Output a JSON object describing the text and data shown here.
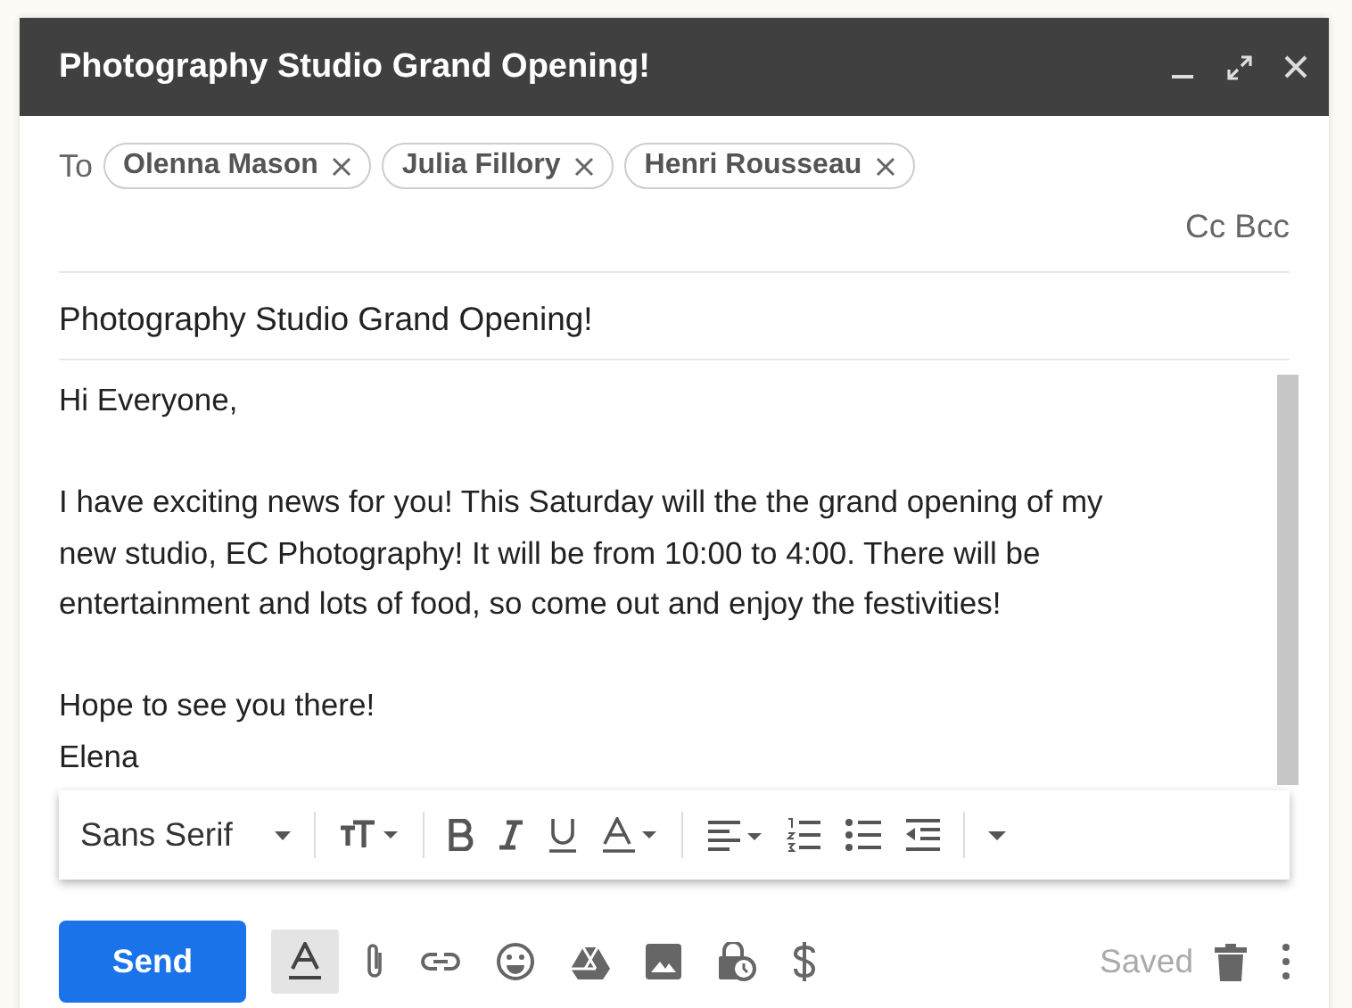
{
  "window": {
    "title": "Photography Studio Grand Opening!"
  },
  "recipients": {
    "label": "To",
    "chips": [
      "Olenna Mason",
      "Julia Fillory",
      "Henri Rousseau"
    ],
    "cc": "Cc",
    "bcc": "Bcc"
  },
  "subject": {
    "value": "Photography Studio Grand Opening!"
  },
  "body": {
    "paragraphs": [
      [
        "Hi Everyone,"
      ],
      [
        "I have exciting news for you! This Saturday will the the grand opening of my",
        "new studio, EC Photography! It will be from 10:00 to 4:00. There will be",
        "entertainment and lots of food, so come out and enjoy the festivities!"
      ],
      [
        "Hope to see you there!",
        "Elena"
      ]
    ]
  },
  "format_toolbar": {
    "font": "Sans Serif"
  },
  "bottom_bar": {
    "send": "Send",
    "formatting_on": true,
    "status": "Saved"
  }
}
